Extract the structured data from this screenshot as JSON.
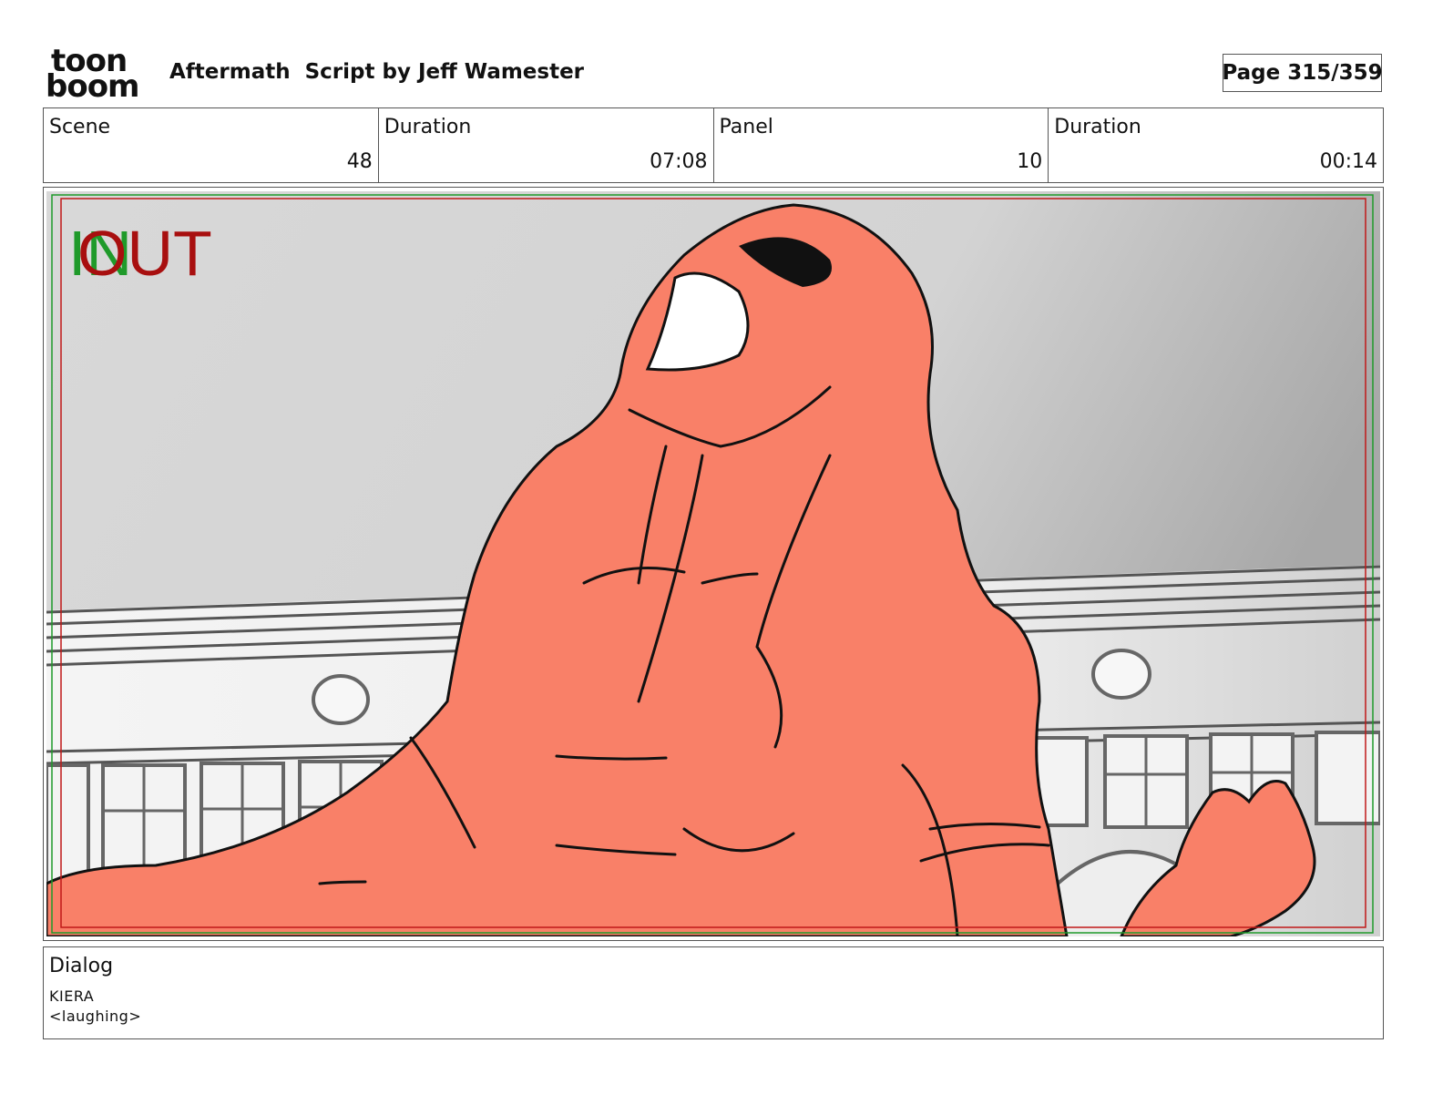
{
  "header": {
    "logo_line1": "toon",
    "logo_line2": "boom",
    "title": "Aftermath  Script by Jeff Wamester",
    "page": "Page 315/359"
  },
  "info": [
    {
      "label": "Scene",
      "value": "48"
    },
    {
      "label": "Duration",
      "value": "07:08"
    },
    {
      "label": "Panel",
      "value": "10"
    },
    {
      "label": "Duration",
      "value": "00:14"
    }
  ],
  "panel": {
    "marker_in": "IN",
    "marker_out": "OUT",
    "in_color": "#1f9a2a",
    "out_color": "#a80f0f",
    "skin_color": "#f98068"
  },
  "dialog": {
    "label": "Dialog",
    "character": "KIERA",
    "line": "<laughing>"
  }
}
